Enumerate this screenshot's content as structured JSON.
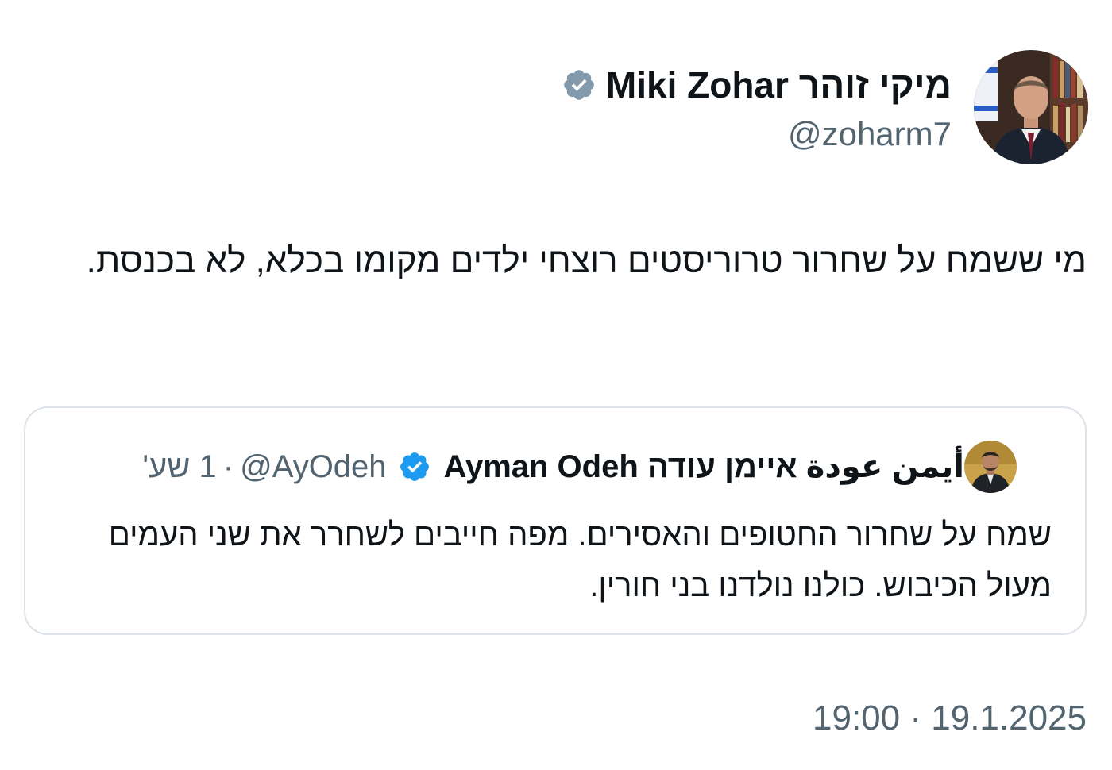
{
  "author": {
    "display_name": "מיקי זוהר Miki Zohar",
    "handle": "@zoharm7",
    "badge": "gray-verified-icon",
    "avatar": "profile-photo"
  },
  "tweet": {
    "text": "מי ששמח על שחרור טרוריסטים רוצחי ילדים מקומו בכלא, לא בכנסת."
  },
  "quoted_tweet": {
    "display_name": "Ayman Odeh أيمن عودة איימן עודה",
    "handle": "@AyOdeh",
    "separator": "·",
    "time": "1 שע'",
    "badge": "blue-verified-icon",
    "text": "שמח על שחרור החטופים והאסירים. מפה חייבים לשחרר את שני העמים מעול הכיבוש. כולנו נולדנו בני חורין."
  },
  "timestamp": {
    "time": "19:00",
    "separator": "·",
    "date": "19.1.2025"
  },
  "colors": {
    "text": "#0f1419",
    "secondary": "#536471",
    "verified_blue": "#1d9bf0",
    "verified_gray": "#829aab",
    "border": "#dde3e8"
  }
}
